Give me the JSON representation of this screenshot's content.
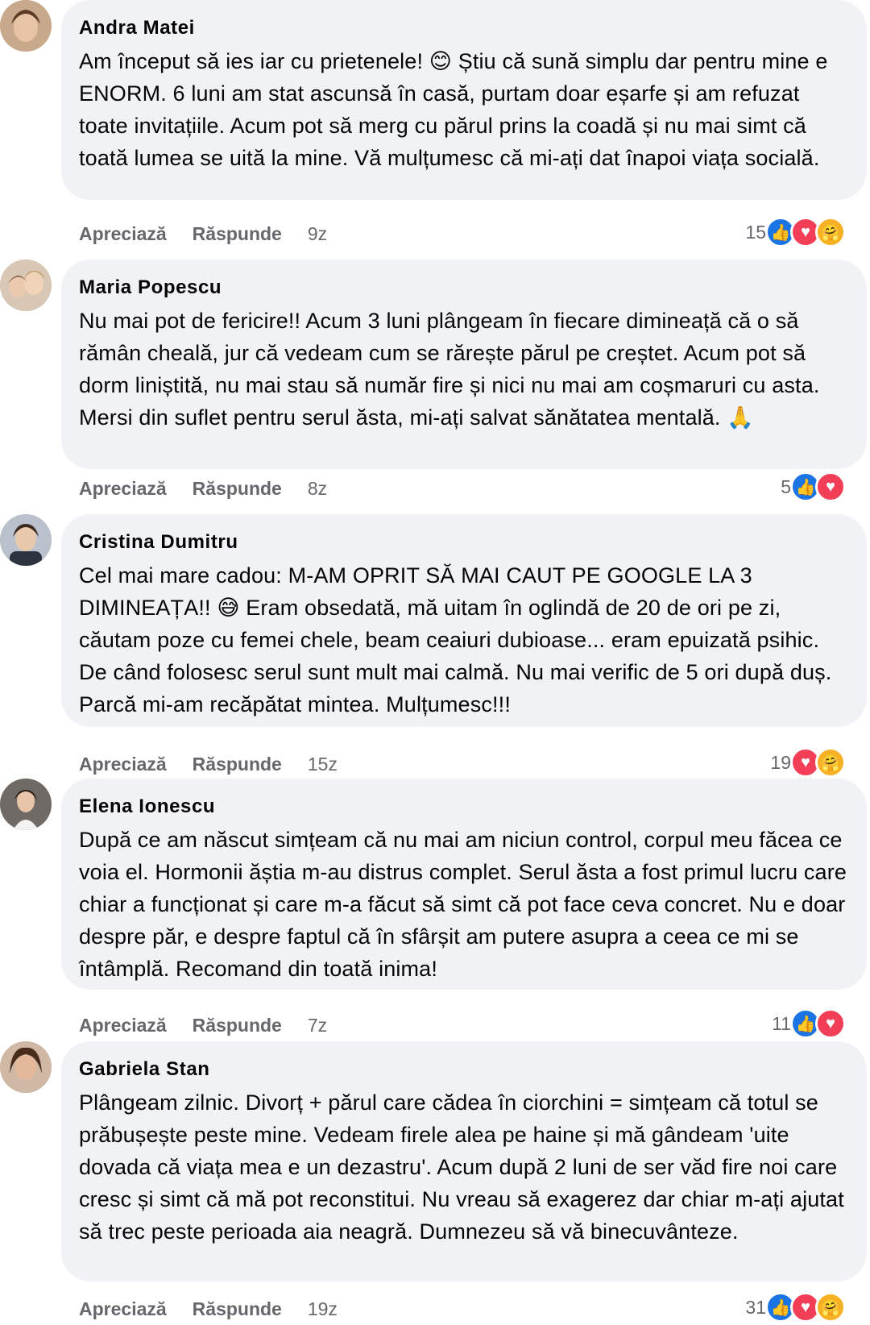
{
  "colors": {
    "bubble": "#f0f2f5",
    "secondary_text": "#65676b",
    "like_blue": "#1b74e4",
    "love_red": "#f33e58",
    "care_yellow": "#f7b125"
  },
  "actions": {
    "like_label": "Apreciază",
    "reply_label": "Răspunde"
  },
  "comments": [
    {
      "author": "Andra Matei",
      "text": "Am început să ies iar cu prietenele! 😊 Știu că sună simplu dar pentru mine e ENORM. 6 luni am stat ascunsă în casă, purtam doar eșarfe și am refuzat toate invitațiile. Acum pot să merg cu părul prins la coadă și nu mai simt că toată lumea se uită la mine. Vă mulțumesc că mi-ați dat înapoi viața socială.",
      "time": "9z",
      "reaction_count": "15",
      "reactions": [
        "like-icon",
        "love-icon",
        "care-icon"
      ]
    },
    {
      "author": "Maria Popescu",
      "text": "Nu mai pot de fericire!! Acum 3 luni plângeam în fiecare dimineață că o să rămân cheală, jur că vedeam cum se rărește părul pe creștet. Acum pot să dorm liniștită, nu mai stau să număr fire și nici nu mai am coșmaruri cu asta. Mersi din suflet pentru serul ăsta, mi-ați salvat sănătatea mentală. 🙏",
      "time": "8z",
      "reaction_count": "5",
      "reactions": [
        "like-icon",
        "love-icon"
      ]
    },
    {
      "author": "Cristina Dumitru",
      "text": "Cel mai mare cadou: M-AM OPRIT SĂ MAI CAUT PE GOOGLE LA 3 DIMINEAȚA!! 😅 Eram obsedată, mă uitam în oglindă de 20 de ori pe zi, căutam poze cu femei chele, beam ceaiuri dubioase... eram epuizată psihic. De când folosesc serul sunt mult mai calmă. Nu mai verific de 5 ori după duș. Parcă mi-am recăpătat mintea. Mulțumesc!!!",
      "time": "15z",
      "reaction_count": "19",
      "reactions": [
        "love-icon",
        "care-icon"
      ]
    },
    {
      "author": "Elena Ionescu",
      "text": "După ce am născut simțeam că nu mai am niciun control, corpul meu făcea ce voia el. Hormonii ăștia m-au distrus complet. Serul ăsta a fost primul lucru care chiar a funcționat și care m-a făcut să simt că pot face ceva concret. Nu e doar despre păr, e despre faptul că în sfârșit am putere asupra a ceea ce mi se întâmplă. Recomand din toată inima!",
      "time": "7z",
      "reaction_count": "11",
      "reactions": [
        "like-icon",
        "love-icon"
      ]
    },
    {
      "author": "Gabriela Stan",
      "text": "Plângeam zilnic. Divorț + părul care cădea în ciorchini = simțeam că totul se prăbușește peste mine. Vedeam firele alea pe haine și mă gândeam 'uite dovada că viața mea e un dezastru'. Acum după 2 luni de ser văd fire noi care cresc și simt că mă pot reconstitui. Nu vreau să exagerez dar chiar m-ați ajutat să trec peste perioada aia neagră. Dumnezeu să vă binecuvânteze.",
      "time": "19z",
      "reaction_count": "31",
      "reactions": [
        "like-icon",
        "love-icon",
        "care-icon"
      ]
    }
  ]
}
